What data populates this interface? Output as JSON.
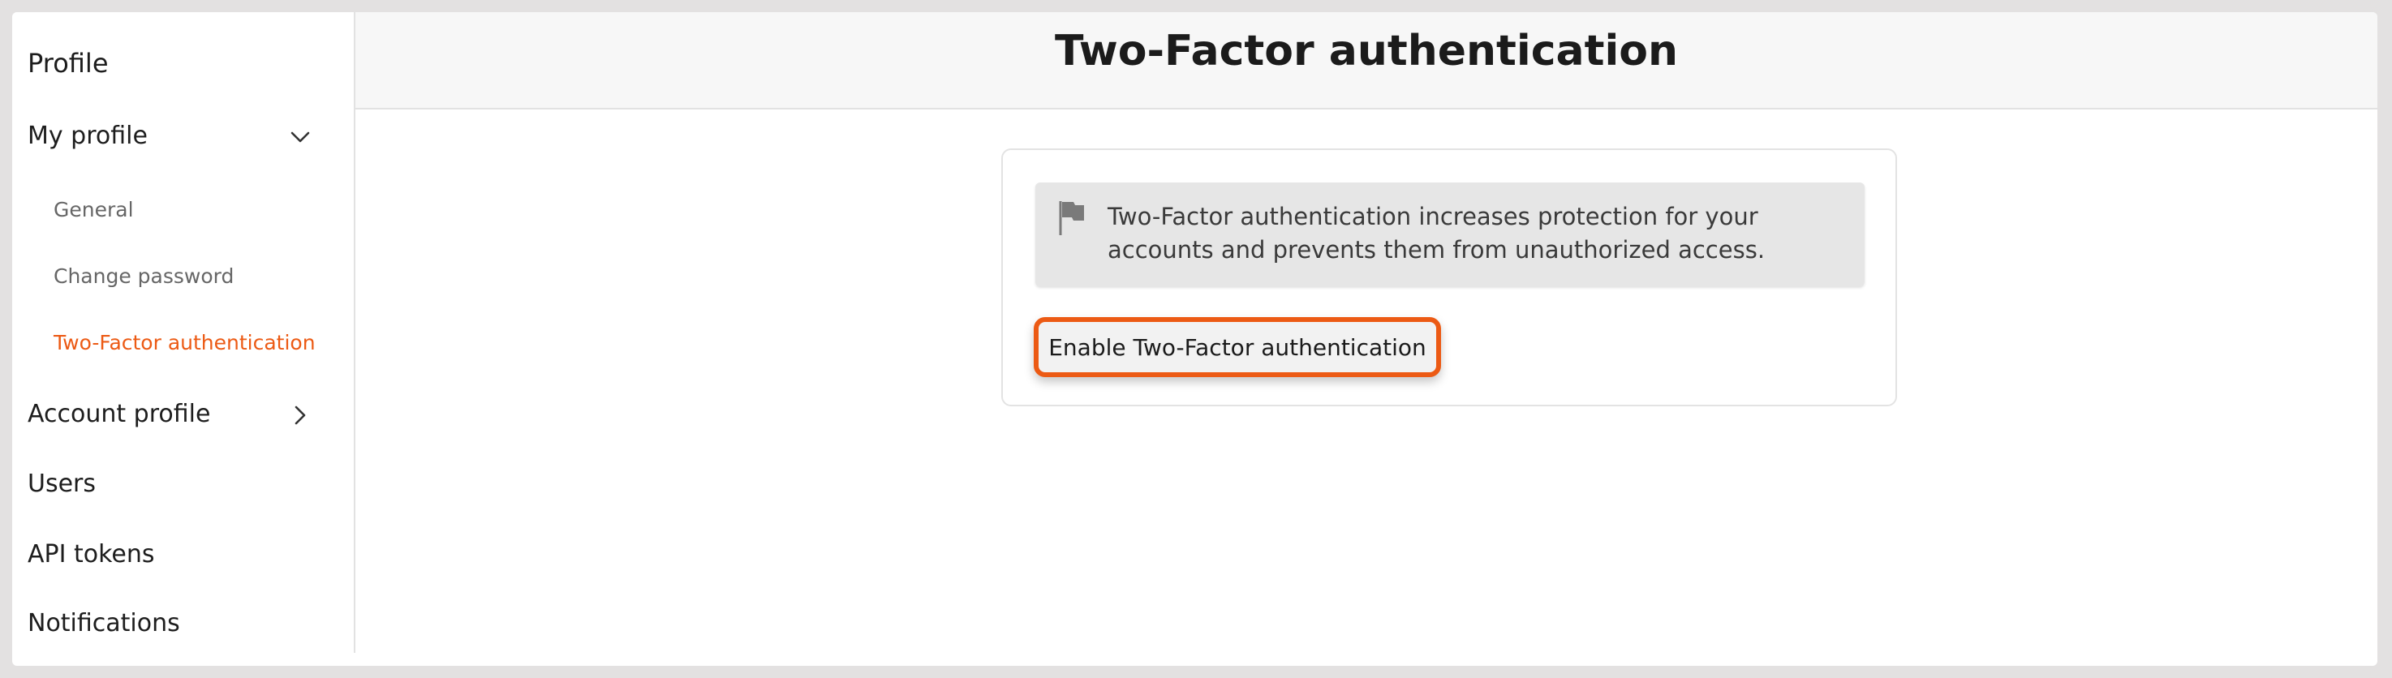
{
  "sidebar": {
    "title": "Profile",
    "items": [
      {
        "label": "My profile",
        "expanded": true,
        "icon": "chevron-down-icon"
      },
      {
        "label": "General"
      },
      {
        "label": "Change password"
      },
      {
        "label": "Two-Factor authentication",
        "active": true
      },
      {
        "label": "Account profile",
        "expanded": false,
        "icon": "chevron-right-icon"
      },
      {
        "label": "Users"
      },
      {
        "label": "API tokens"
      },
      {
        "label": "Notifications"
      }
    ]
  },
  "header": {
    "title": "Two-Factor authentication"
  },
  "main": {
    "info_icon": "flag-icon",
    "info_text": "Two-Factor authentication increases protection for your accounts and prevents them from unauthorized access.",
    "enable_button_label": "Enable Two-Factor authentication"
  },
  "colors": {
    "accent": "#ec5a14",
    "header_bg": "#f7f7f7",
    "info_bg": "#e6e6e6",
    "page_bg": "#e3e1e1"
  }
}
